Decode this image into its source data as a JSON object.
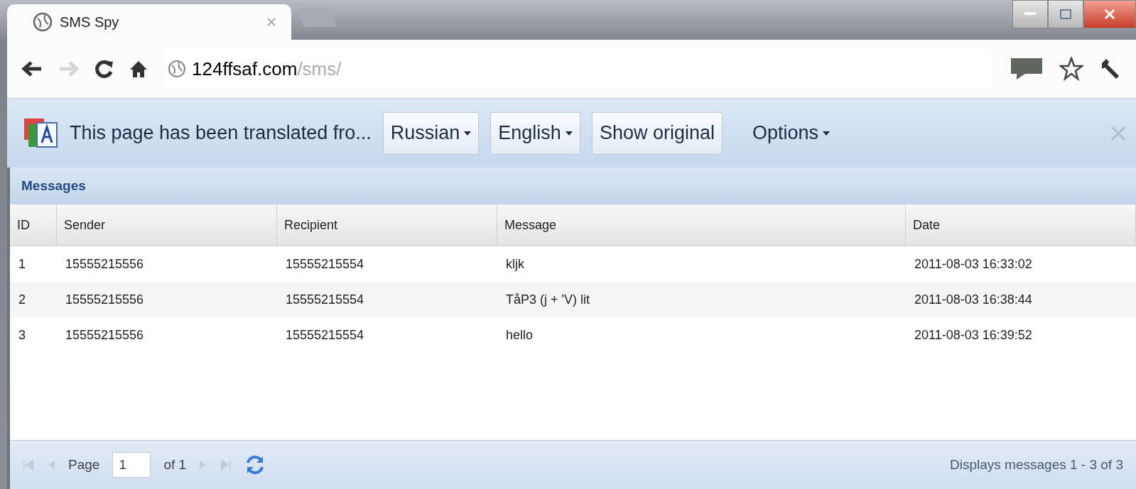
{
  "tabs": [
    {
      "label": "SMS Spy",
      "selected": true
    }
  ],
  "address_bar": {
    "host": "124ffsaf.com",
    "path": "/sms/"
  },
  "translate_bar": {
    "message": "This page has been translated fro...",
    "source_language": "Russian",
    "target_language": "English",
    "show_original": "Show original",
    "options": "Options"
  },
  "panel": {
    "title": "Messages"
  },
  "table": {
    "columns": [
      "ID",
      "Sender",
      "Recipient",
      "Message",
      "Date"
    ],
    "rows": [
      [
        "1",
        "15555215556",
        "15555215554",
        "kljk",
        "2011-08-03 16:33:02"
      ],
      [
        "2",
        "15555215556",
        "15555215554",
        "TåP3 (j + 'V) lit",
        "2011-08-03 16:38:44"
      ],
      [
        "3",
        "15555215556",
        "15555215554",
        "hello",
        "2011-08-03 16:39:52"
      ]
    ]
  },
  "pager": {
    "page_label": "Page",
    "page": "1",
    "of_label": "of 1",
    "status": "Displays messages 1 - 3 of 3"
  }
}
